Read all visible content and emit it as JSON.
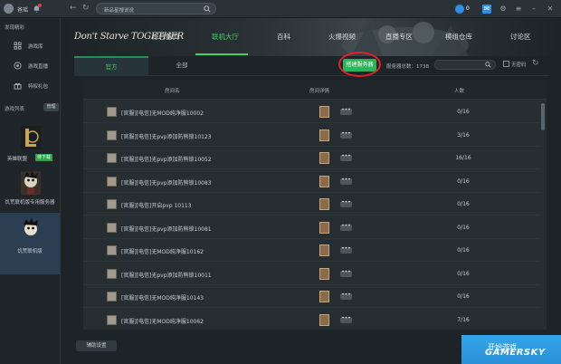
{
  "titlebar": {
    "username": "爸瑶",
    "search_placeholder": "新品星搜说说",
    "coin_value": "0"
  },
  "sidebar": {
    "section_discover": "发现精彩",
    "items": [
      {
        "label": "游戏库",
        "icon": "grid-icon"
      },
      {
        "label": "游戏直播",
        "icon": "broadcast-icon"
      },
      {
        "label": "特权礼包",
        "icon": "gift-icon"
      }
    ],
    "section_games": "游戏列表",
    "manage_label": "管理",
    "games": [
      {
        "name": "英雄联盟",
        "badge": "待下载"
      },
      {
        "name": "饥荒联机版专用服务器"
      },
      {
        "name": "饥荒联机版"
      }
    ]
  },
  "banner": {
    "logo_text": "Don't Starve TOGETHER",
    "tabs": [
      "综合首页",
      "联机大厅",
      "百科",
      "火爆视频",
      "直播专区",
      "模组仓库",
      "讨论区"
    ],
    "active_tab": "联机大厅"
  },
  "lobby": {
    "subtabs": [
      "官方",
      "全部"
    ],
    "create_label": "搭建服务器",
    "server_count": "服务器总数：1738",
    "no_password_label": "无密码",
    "headers": {
      "name": "房间名",
      "detail": "房间详情",
      "players": "人数"
    },
    "rows": [
      {
        "name": "[官服][电信]无MOD纯净服10002",
        "players": "0/16"
      },
      {
        "name": "[官服][电信]无pvp添加防熊锁10123",
        "players": "3/16"
      },
      {
        "name": "[官服][电信]无pvp添加防熊锁10052",
        "players": "16/16"
      },
      {
        "name": "[官服][电信]无pvp添加防熊锁10083",
        "players": "0/16"
      },
      {
        "name": "[官服][电信]开启pvp 10113",
        "players": "0/16"
      },
      {
        "name": "[官服][电信]无pvp添加防熊锁10081",
        "players": "0/16"
      },
      {
        "name": "[官服][电信]无MOD纯净服10162",
        "players": "0/16"
      },
      {
        "name": "[官服][电信]无pvp添加防熊锁10011",
        "players": "0/16"
      },
      {
        "name": "[官服][电信]无MOD纯净服10143",
        "players": "0/16"
      },
      {
        "name": "[官服][电信]无MOD纯净服10062",
        "players": "7/16"
      }
    ],
    "more_label": "•••",
    "assist_label": "辅助设置",
    "start_label": "开始游戏"
  },
  "watermark": "GAMERSKY",
  "colors": {
    "accent_green": "#3fd068",
    "create_green": "#2bb45a",
    "start_blue": "#2a8fd6",
    "highlight_red": "#e4202a"
  }
}
